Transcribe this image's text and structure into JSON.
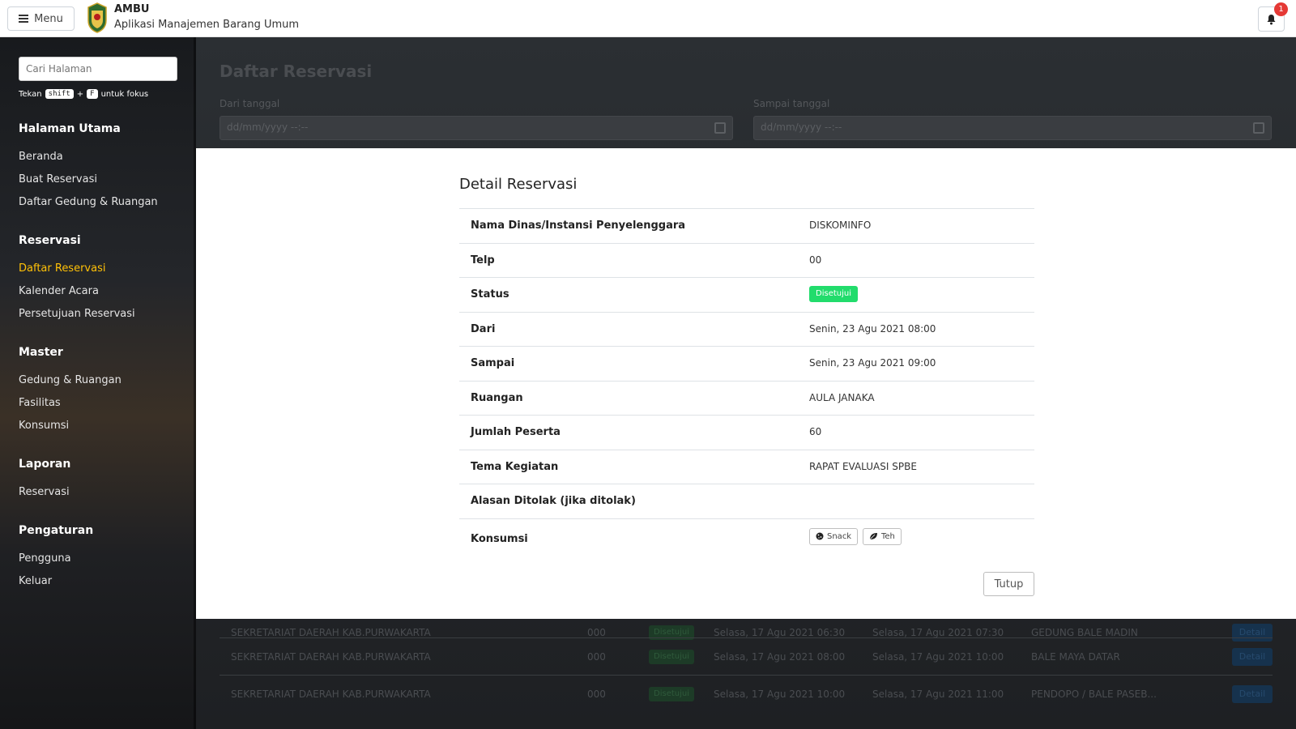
{
  "topbar": {
    "menu_label": "Menu",
    "brand_title": "AMBU",
    "brand_subtitle": "Aplikasi Manajemen Barang Umum",
    "notification_count": "1"
  },
  "sidebar": {
    "search_placeholder": "Cari Halaman",
    "hint_prefix": "Tekan",
    "hint_key1": "shift",
    "hint_plus": "+",
    "hint_key2": "F",
    "hint_suffix": "untuk fokus",
    "sections": [
      {
        "title": "Halaman Utama",
        "items": [
          "Beranda",
          "Buat Reservasi",
          "Daftar Gedung & Ruangan"
        ]
      },
      {
        "title": "Reservasi",
        "items": [
          "Daftar Reservasi",
          "Kalender Acara",
          "Persetujuan Reservasi"
        ]
      },
      {
        "title": "Master",
        "items": [
          "Gedung & Ruangan",
          "Fasilitas",
          "Konsumsi"
        ]
      },
      {
        "title": "Laporan",
        "items": [
          "Reservasi"
        ]
      },
      {
        "title": "Pengaturan",
        "items": [
          "Pengguna",
          "Keluar"
        ]
      }
    ],
    "active_item": "Daftar Reservasi"
  },
  "main": {
    "title": "Daftar Reservasi",
    "from_label": "Dari tanggal",
    "to_label": "Sampai tanggal",
    "date_placeholder": "dd/mm/yyyy --:--",
    "rows": [
      {
        "org": "SEKRETARIAT DAERAH KAB.PURWAKARTA",
        "telp": "000",
        "status": "Disetujui",
        "from": "Selasa, 17 Agu 2021 06:30",
        "to": "Selasa, 17 Agu 2021 07:30",
        "room": "GEDUNG BALE MADIN",
        "action": "Detail"
      },
      {
        "org": "SEKRETARIAT DAERAH KAB.PURWAKARTA",
        "telp": "000",
        "status": "Disetujui",
        "from": "Selasa, 17 Agu 2021 08:00",
        "to": "Selasa, 17 Agu 2021 10:00",
        "room": "BALE MAYA DATAR",
        "action": "Detail"
      },
      {
        "org": "SEKRETARIAT DAERAH KAB.PURWAKARTA",
        "telp": "000",
        "status": "Disetujui",
        "from": "Selasa, 17 Agu 2021 10:00",
        "to": "Selasa, 17 Agu 2021 11:00",
        "room": "PENDOPO / BALE PASEB...",
        "action": "Detail"
      }
    ]
  },
  "modal": {
    "title": "Detail Reservasi",
    "labels": {
      "org": "Nama Dinas/Instansi Penyelenggara",
      "telp": "Telp",
      "status": "Status",
      "from": "Dari",
      "to": "Sampai",
      "room": "Ruangan",
      "participants": "Jumlah Peserta",
      "theme": "Tema Kegiatan",
      "reject_reason": "Alasan Ditolak (jika ditolak)",
      "consumption": "Konsumsi"
    },
    "values": {
      "org": "DISKOMINFO",
      "telp": "00",
      "status": "Disetujui",
      "from": "Senin, 23 Agu 2021 08:00",
      "to": "Senin, 23 Agu 2021 09:00",
      "room": "AULA JANAKA",
      "participants": "60",
      "theme": "RAPAT EVALUASI SPBE",
      "reject_reason": "",
      "consumption": [
        "Snack",
        "Teh"
      ]
    },
    "close_label": "Tutup",
    "status_color": "#22dc6c"
  }
}
